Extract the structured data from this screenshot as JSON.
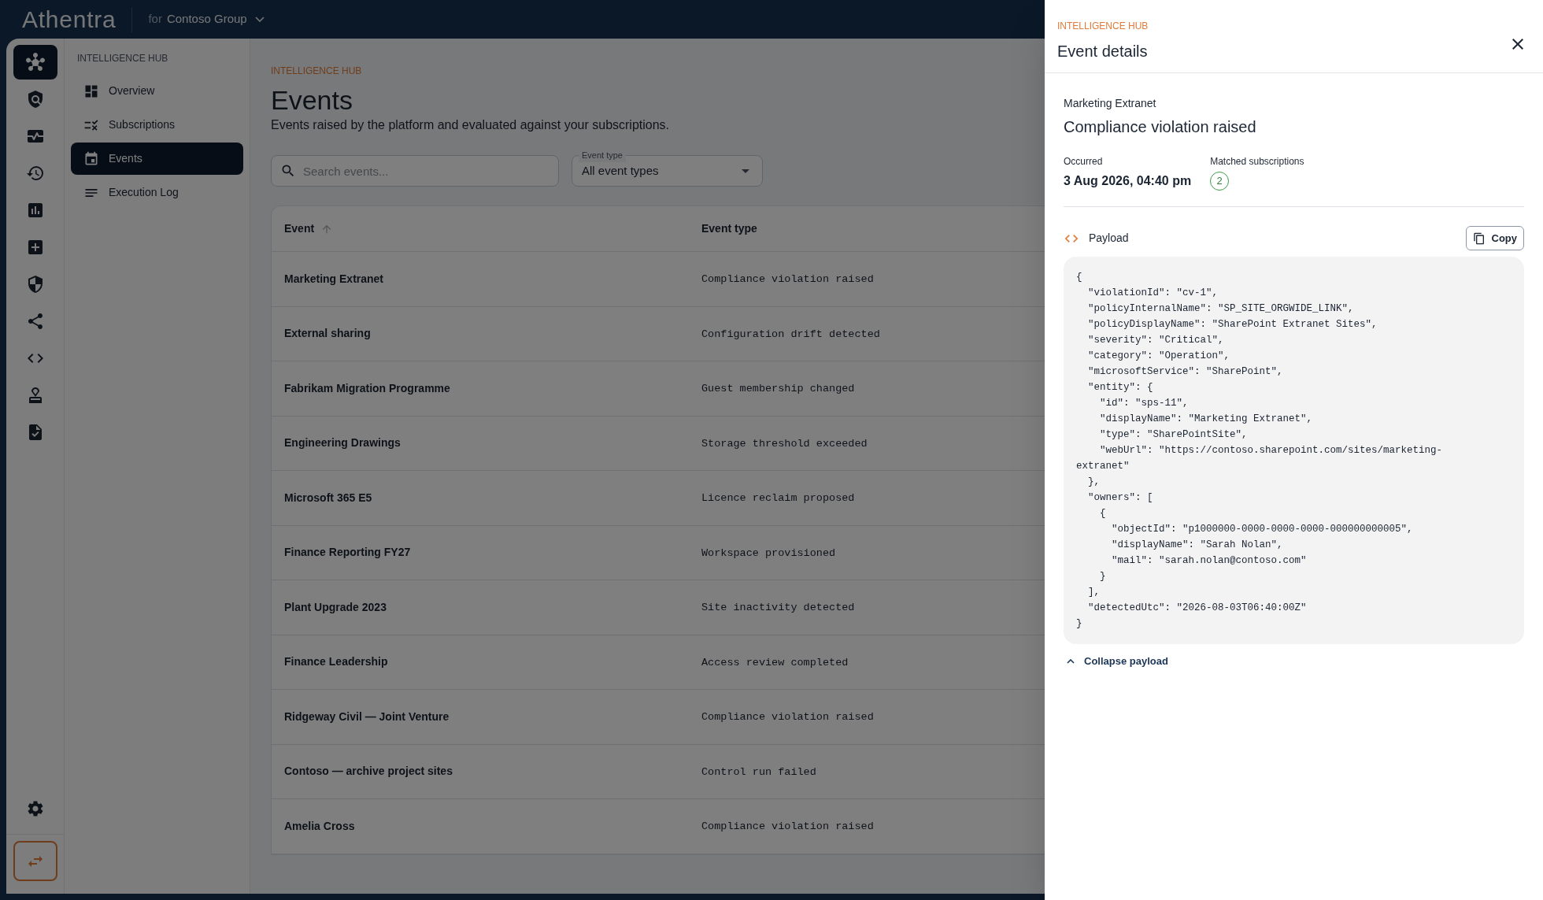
{
  "header": {
    "logo": "Athentra",
    "tenant_prefix": "for",
    "tenant": "Contoso Group"
  },
  "rail": {
    "items": [
      {
        "selected": true
      },
      {
        "selected": false
      },
      {
        "selected": false
      },
      {
        "selected": false
      },
      {
        "selected": false
      },
      {
        "selected": false
      },
      {
        "selected": false
      },
      {
        "selected": false
      },
      {
        "selected": false
      },
      {
        "selected": false
      },
      {
        "selected": false
      }
    ]
  },
  "nav": {
    "heading": "INTELLIGENCE HUB",
    "items": [
      {
        "label": "Overview",
        "selected": false
      },
      {
        "label": "Subscriptions",
        "selected": false
      },
      {
        "label": "Events",
        "selected": true
      },
      {
        "label": "Execution Log",
        "selected": false
      }
    ]
  },
  "page": {
    "breadcrumb": "INTELLIGENCE HUB",
    "title": "Events",
    "subtitle": "Events raised by the platform and evaluated against your subscriptions.",
    "search": {
      "placeholder": "Search events..."
    },
    "filter": {
      "label": "Event type",
      "value": "All event types"
    },
    "table": {
      "columns": [
        {
          "label": "Event",
          "sorted": true
        },
        {
          "label": "Event type",
          "sorted": false
        }
      ],
      "rows": [
        {
          "event": "Marketing Extranet",
          "event_type": "Compliance violation raised"
        },
        {
          "event": "External sharing",
          "event_type": "Configuration drift detected"
        },
        {
          "event": "Fabrikam Migration Programme",
          "event_type": "Guest membership changed"
        },
        {
          "event": "Engineering Drawings",
          "event_type": "Storage threshold exceeded"
        },
        {
          "event": "Microsoft 365 E5",
          "event_type": "Licence reclaim proposed"
        },
        {
          "event": "Finance Reporting FY27",
          "event_type": "Workspace provisioned"
        },
        {
          "event": "Plant Upgrade 2023",
          "event_type": "Site inactivity detected"
        },
        {
          "event": "Finance Leadership",
          "event_type": "Access review completed"
        },
        {
          "event": "Ridgeway Civil — Joint Venture",
          "event_type": "Compliance violation raised"
        },
        {
          "event": "Contoso — archive project sites",
          "event_type": "Control run failed"
        },
        {
          "event": "Amelia Cross",
          "event_type": "Compliance violation raised"
        }
      ]
    }
  },
  "drawer": {
    "breadcrumb": "INTELLIGENCE HUB",
    "title": "Event details",
    "source": "Marketing Extranet",
    "event_title": "Compliance violation raised",
    "occurred_label": "Occurred",
    "occurred": "3 Aug 2026, 04:40 pm",
    "matched_label": "Matched subscriptions",
    "matched_count": "2",
    "payload_label": "Payload",
    "copy_label": "Copy",
    "payload_lines": [
      "{",
      "  \"violationId\": \"cv-1\",",
      "  \"policyInternalName\": \"SP_SITE_ORGWIDE_LINK\",",
      "  \"policyDisplayName\": \"SharePoint Extranet Sites\",",
      "  \"severity\": \"Critical\",",
      "  \"category\": \"Operation\",",
      "  \"microsoftService\": \"SharePoint\",",
      "  \"entity\": {",
      "    \"id\": \"sps-11\",",
      "    \"displayName\": \"Marketing Extranet\",",
      "    \"type\": \"SharePointSite\",",
      "    \"webUrl\": \"https://contoso.sharepoint.com/sites/marketing-",
      "extranet\"",
      "  },",
      "  \"owners\": [",
      "    {",
      "      \"objectId\": \"p1000000-0000-0000-0000-000000000005\",",
      "      \"displayName\": \"Sarah Nolan\",",
      "      \"mail\": \"sarah.nolan@contoso.com\"",
      "    }",
      "  ],",
      "  \"detectedUtc\": \"2026-08-03T06:40:00Z\"",
      "}"
    ],
    "collapse_label": "Collapse payload"
  }
}
